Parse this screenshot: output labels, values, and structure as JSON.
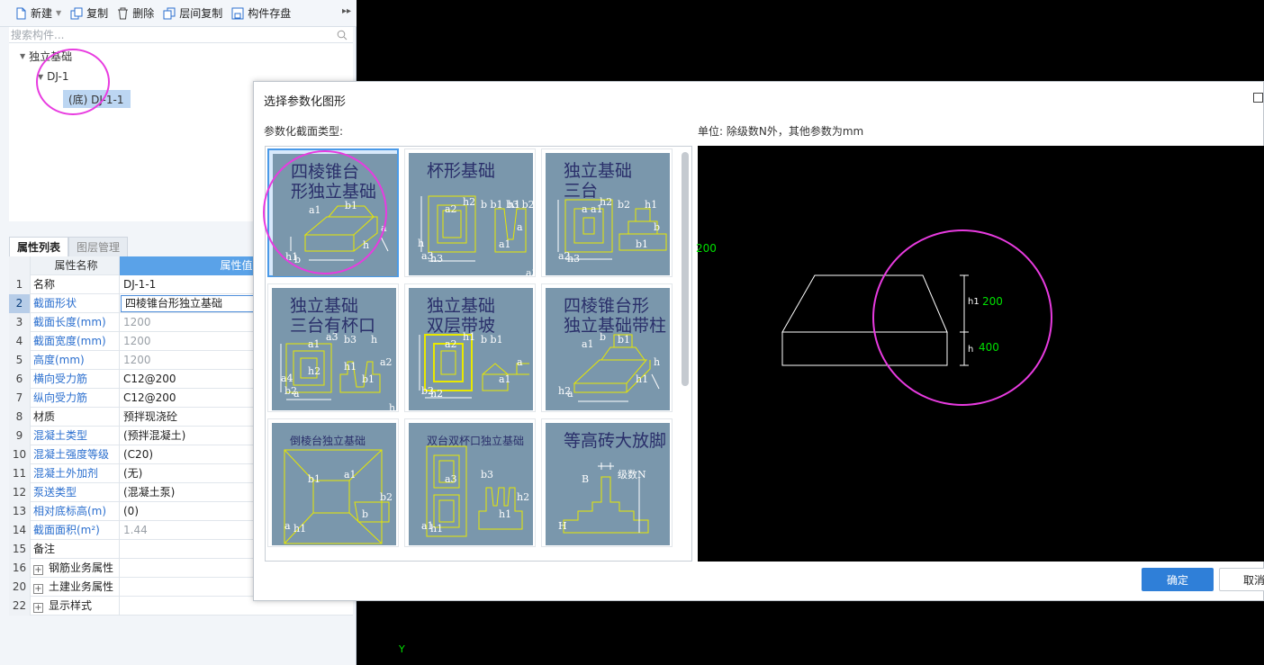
{
  "toolbar": {
    "new_label": "新建",
    "copy_label": "复制",
    "delete_label": "删除",
    "floor_copy_label": "层间复制",
    "save_label": "构件存盘"
  },
  "search": {
    "placeholder": "搜索构件..."
  },
  "tree": {
    "root": "独立基础",
    "child": "DJ-1",
    "leaf": "(底) DJ-1-1"
  },
  "tabs": {
    "properties": "属性列表",
    "layers": "图层管理"
  },
  "grid": {
    "header_name": "属性名称",
    "header_value": "属性值",
    "rows": [
      {
        "no": "1",
        "name": "名称",
        "value": "DJ-1-1"
      },
      {
        "no": "2",
        "name": "截面形状",
        "value": "四棱锥台形独立基础"
      },
      {
        "no": "3",
        "name": "截面长度(mm)",
        "value": "1200"
      },
      {
        "no": "4",
        "name": "截面宽度(mm)",
        "value": "1200"
      },
      {
        "no": "5",
        "name": "高度(mm)",
        "value": "1200"
      },
      {
        "no": "6",
        "name": "横向受力筋",
        "value": "C12@200"
      },
      {
        "no": "7",
        "name": "纵向受力筋",
        "value": "C12@200"
      },
      {
        "no": "8",
        "name": "材质",
        "value": "预拌现浇砼"
      },
      {
        "no": "9",
        "name": "混凝土类型",
        "value": "(预拌混凝土)"
      },
      {
        "no": "10",
        "name": "混凝土强度等级",
        "value": "(C20)"
      },
      {
        "no": "11",
        "name": "混凝土外加剂",
        "value": "(无)"
      },
      {
        "no": "12",
        "name": "泵送类型",
        "value": "(混凝土泵)"
      },
      {
        "no": "13",
        "name": "相对底标高(m)",
        "value": "(0)"
      },
      {
        "no": "14",
        "name": "截面面积(m²)",
        "value": "1.44"
      },
      {
        "no": "15",
        "name": "备注",
        "value": ""
      },
      {
        "no": "16",
        "name": "钢筋业务属性",
        "value": ""
      },
      {
        "no": "20",
        "name": "土建业务属性",
        "value": ""
      },
      {
        "no": "22",
        "name": "显示样式",
        "value": ""
      }
    ]
  },
  "dialog": {
    "title": "选择参数化图形",
    "type_label": "参数化截面类型:",
    "unit_label": "单位:   除级数N外，其他参数为mm",
    "ok": "确定",
    "cancel": "取消"
  },
  "shapes": [
    {
      "title1": "四棱锥台",
      "title2": "形独立基础",
      "labels": [
        "a1",
        "b1",
        "h1",
        "h",
        "a",
        "b"
      ]
    },
    {
      "title1": "杯形基础",
      "title2": "",
      "labels": [
        "a2",
        "b b1 b3 b2",
        "a3",
        "a1",
        "a",
        "h3",
        "h2",
        "h1",
        "h",
        "a3"
      ]
    },
    {
      "title1": "独立基础",
      "title2": "三台",
      "labels": [
        "a a1",
        "b2",
        "a2",
        "b1",
        "b",
        "h3",
        "h2",
        "h1"
      ]
    },
    {
      "title1": "独立基础",
      "title2": "三台有杯口",
      "labels": [
        "a1",
        "b3",
        "b2",
        "b1",
        "a2",
        "a",
        "a3",
        "h",
        "a4",
        "h3",
        "h2",
        "h1",
        "b"
      ]
    },
    {
      "title1": "独立基础",
      "title2": "双层带坡",
      "labels": [
        "a2",
        "b b1",
        "b2",
        "a1",
        "a",
        "h2",
        "h1"
      ]
    },
    {
      "title1": "四棱锥台形",
      "title2": "独立基础带柱",
      "labels": [
        "a1",
        "b1",
        "h2",
        "h1",
        "h",
        "a",
        "b"
      ]
    },
    {
      "title1": "倒棱台独立基础",
      "title2": "",
      "labels": [
        "b1",
        "a1",
        "a",
        "b",
        "b2",
        "h1"
      ]
    },
    {
      "title1": "双台双杯口独立基础",
      "title2": "",
      "labels": [
        "a3",
        "b3",
        "a1",
        "h1",
        "h2",
        "h1"
      ]
    },
    {
      "title1": "等高砖大放脚",
      "title2": "",
      "labels": [
        "B",
        "级数N",
        "H"
      ]
    }
  ],
  "preview": {
    "h1_label": "h1",
    "h1_value": "200",
    "h_label": "h",
    "h_value": "400",
    "left_value": "200"
  },
  "canvas": {
    "axis_label": "Y"
  },
  "colors": {
    "accent": "#2f7fd8",
    "thumb_bg": "#7a97ac",
    "shape_line": "#e8e800",
    "annotation": "#e83be0",
    "preview_value": "#00e000"
  }
}
